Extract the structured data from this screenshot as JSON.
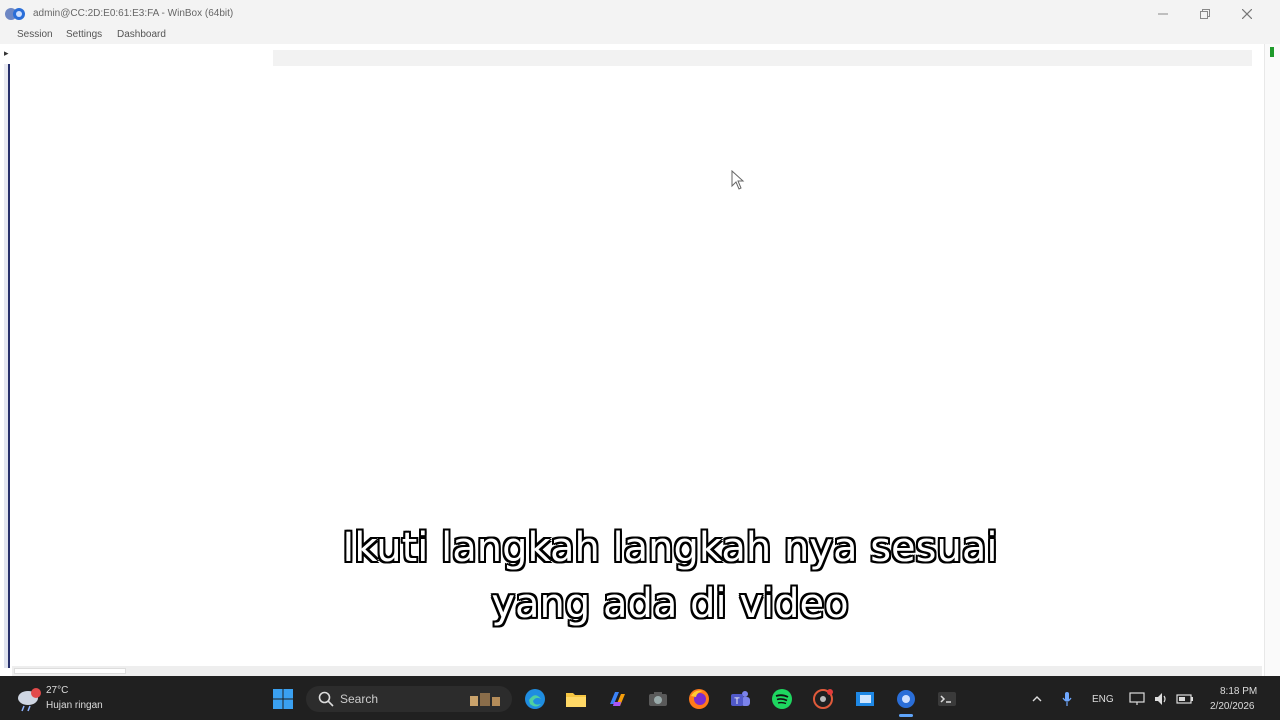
{
  "window": {
    "title": "admin@CC:2D:E0:61:E3:FA - WinBox (64bit)",
    "controls": [
      "minimize",
      "maximize",
      "close"
    ]
  },
  "menu": {
    "items": [
      "Session",
      "Settings",
      "Dashboard"
    ]
  },
  "caption": {
    "line1": "Ikuti langkah langkah nya sesuai",
    "line2": "yang ada di video"
  },
  "taskbar": {
    "weather_temp": "27°C",
    "weather_desc": "Hujan ringan",
    "search_label": "Search",
    "language": "ENG",
    "time": "8:18 PM",
    "date": "2/20/2026",
    "icons": [
      "windows-start-icon",
      "edge-icon",
      "file-explorer-icon",
      "copilot-icon",
      "camera-icon",
      "firefox-icon",
      "teams-icon",
      "spotify-icon",
      "git-icon",
      "mail-icon",
      "winbox-icon",
      "terminal-icon"
    ]
  },
  "colors": {
    "taskbar": "#202020",
    "accent": "#60a5fa",
    "status_green": "#1f9a2b"
  }
}
